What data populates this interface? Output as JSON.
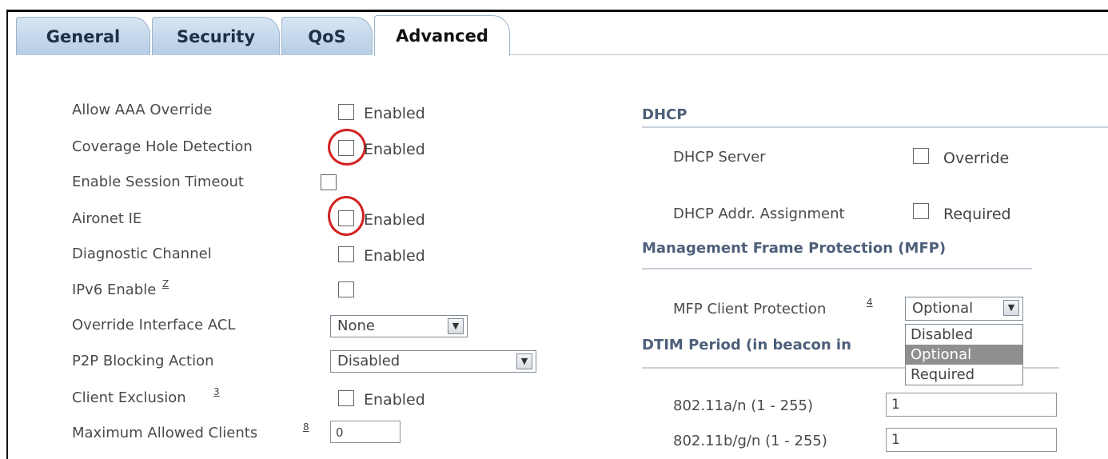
{
  "tabs": [
    {
      "label": "General"
    },
    {
      "label": "Security"
    },
    {
      "label": "QoS"
    },
    {
      "label": "Advanced",
      "active": true
    }
  ],
  "left": {
    "aaa_override": {
      "label": "Allow AAA Override",
      "checkbox_label": "Enabled"
    },
    "coverage_hole": {
      "label": "Coverage Hole Detection",
      "checkbox_label": "Enabled"
    },
    "session_timeout": {
      "label": "Enable Session Timeout"
    },
    "aironet_ie": {
      "label": "Aironet IE",
      "checkbox_label": "Enabled"
    },
    "diagnostic": {
      "label": "Diagnostic Channel",
      "checkbox_label": "Enabled"
    },
    "ipv6": {
      "label": "IPv6 Enable",
      "footnote": "Z"
    },
    "acl": {
      "label": "Override Interface ACL",
      "value": "None"
    },
    "p2p": {
      "label": "P2P Blocking Action",
      "value": "Disabled"
    },
    "client_exclusion": {
      "label": "Client Exclusion",
      "footnote": "3",
      "checkbox_label": "Enabled"
    },
    "max_clients": {
      "label": "Maximum Allowed Clients",
      "footnote": "8",
      "value": "0"
    }
  },
  "right": {
    "dhcp": {
      "header": "DHCP",
      "server": {
        "label": "DHCP Server",
        "checkbox_label": "Override"
      },
      "addr": {
        "label": "DHCP Addr. Assignment",
        "checkbox_label": "Required"
      }
    },
    "mfp": {
      "header": "Management Frame Protection (MFP)",
      "client_protection": {
        "label": "MFP Client Protection",
        "footnote": "4",
        "value": "Optional"
      },
      "options": [
        "Disabled",
        "Optional",
        "Required"
      ]
    },
    "dtim": {
      "header": "DTIM Period (in beacon in",
      "a_n": {
        "label": "802.11a/n (1 - 255)",
        "value": "1"
      },
      "b_g_n": {
        "label": "802.11b/g/n (1 - 255)",
        "value": "1"
      }
    }
  },
  "colors": {
    "highlight_circle": "#d32222",
    "tab_bg": "#c6d9ec",
    "section_header": "#4d5f79"
  }
}
